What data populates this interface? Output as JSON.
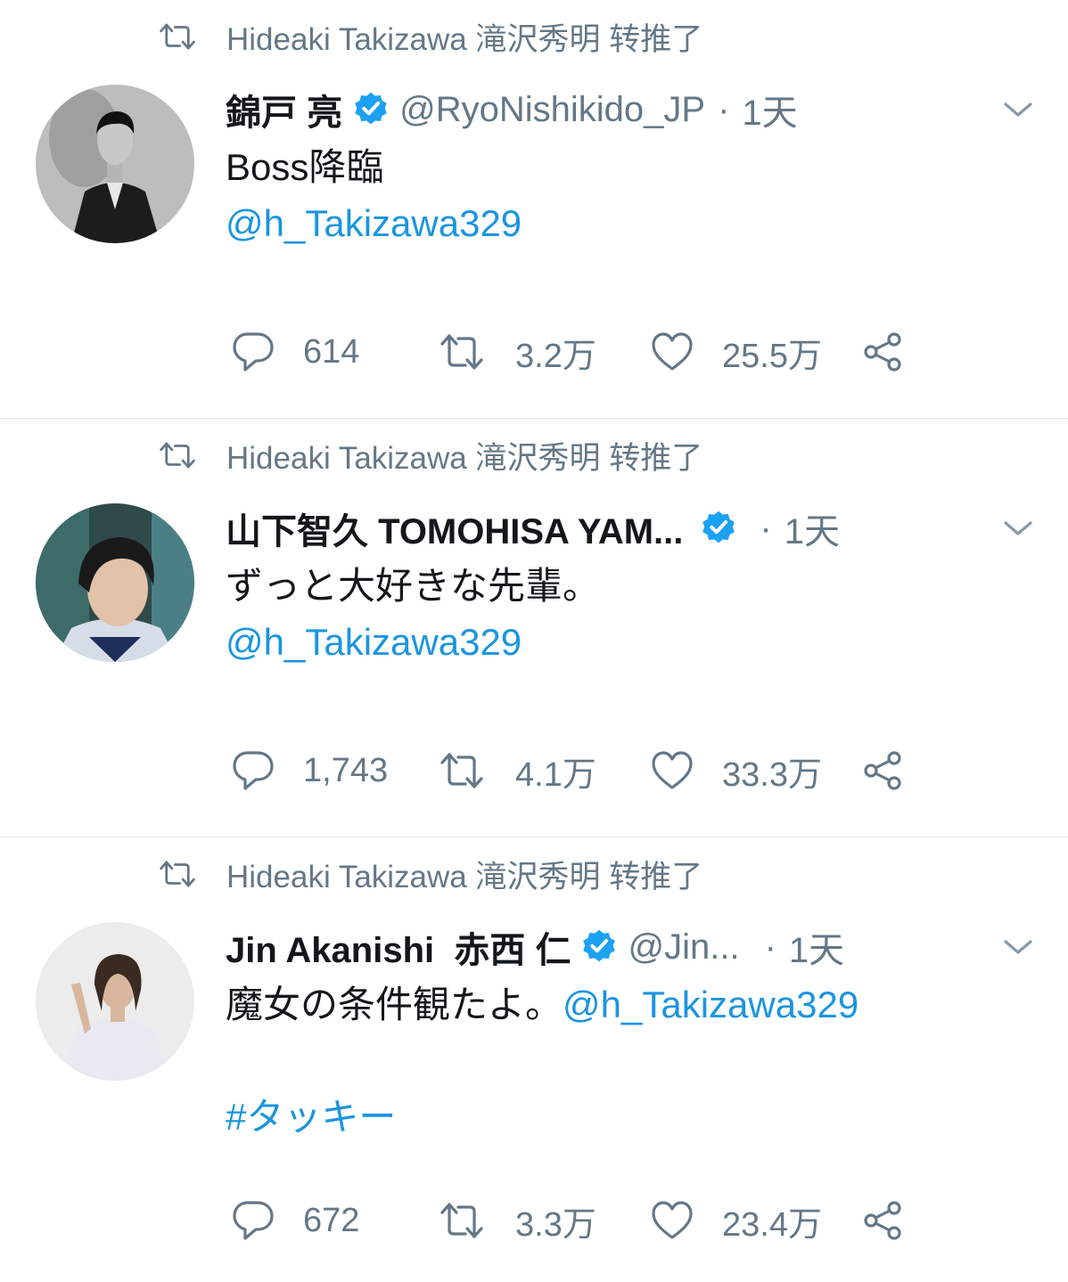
{
  "tweets": [
    {
      "retweeter_text": "Hideaki Takizawa 滝沢秀明 转推了",
      "name": "錦戸 亮",
      "handle": "@RyoNishikido_JP",
      "separator": "·",
      "time": "1天",
      "text_line1": "Boss降臨",
      "mention": "@h_Takizawa329",
      "reply_count": "614",
      "retweet_count": "3.2万",
      "like_count": "25.5万"
    },
    {
      "retweeter_text": "Hideaki Takizawa 滝沢秀明 转推了",
      "name": "山下智久 TOMOHISA YAM...",
      "handle": "",
      "separator": "·",
      "time": "1天",
      "text_line1": "ずっと大好きな先輩。",
      "mention": "@h_Takizawa329",
      "reply_count": "1,743",
      "retweet_count": "4.1万",
      "like_count": "33.3万"
    },
    {
      "retweeter_text": "Hideaki Takizawa 滝沢秀明 转推了",
      "name": "Jin Akanishi  赤西 仁",
      "handle": "@Jin...",
      "separator": "·",
      "time": "1天",
      "text_line1": "魔女の条件観たよ。",
      "mention": "@h_Takizawa329",
      "hashtag": "#タッキー",
      "reply_count": "672",
      "retweet_count": "3.3万",
      "like_count": "23.4万"
    }
  ],
  "colors": {
    "link": "#1b95e0",
    "secondary_text": "#657786",
    "verified_badge": "#1da1f2",
    "divider": "#e1e8ed"
  },
  "icons": [
    "retweet-icon",
    "verified-icon",
    "chevron-down-icon",
    "reply-icon",
    "heart-icon",
    "share-icon"
  ]
}
